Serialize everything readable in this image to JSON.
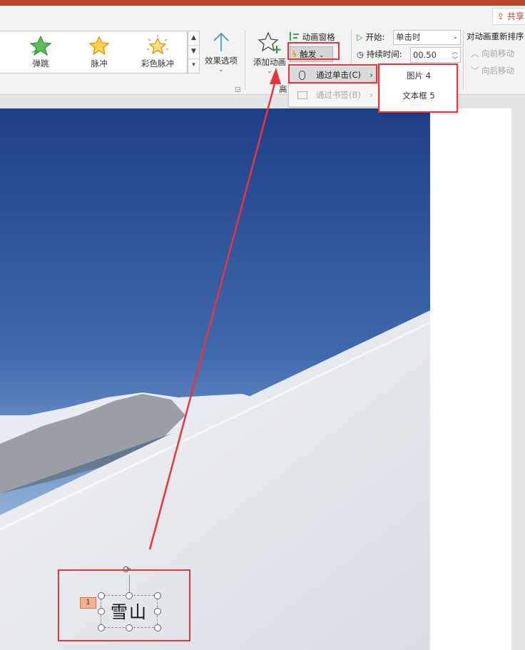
{
  "ribbon": {
    "share_label": "共享",
    "effects": [
      {
        "label": "弹跳",
        "icon": "bounce-star-icon",
        "color": "#3aa34a"
      },
      {
        "label": "脉冲",
        "icon": "pulse-star-icon",
        "color": "#f5a623"
      },
      {
        "label": "彩色脉冲",
        "icon": "color-pulse-star-icon",
        "color": "#f5a623"
      }
    ],
    "effect_options_label": "效果选项",
    "add_animation_label": "添加动画",
    "advanced_hint": "高",
    "animation_pane_label": "动画窗格",
    "trigger_label": "触发",
    "start_label": "开始:",
    "start_value": "单击时",
    "duration_label": "持续时间:",
    "duration_value": "00.50",
    "reorder_title": "对动画重新排序",
    "move_earlier_label": "向前移动",
    "move_later_label": "向后移动"
  },
  "trigger_menu": {
    "items": [
      {
        "label": "通过单击(C)",
        "icon": "mouse-icon",
        "enabled": true
      },
      {
        "label": "通过书签(B)",
        "icon": "bookmark-icon",
        "enabled": false
      }
    ],
    "submenu_items": [
      "图片 4",
      "文本框 5"
    ]
  },
  "slide": {
    "textbox_text": "雪山",
    "animation_order": "1"
  },
  "colors": {
    "accent_red": "#e8353b",
    "ppt_brand": "#b7472a"
  }
}
